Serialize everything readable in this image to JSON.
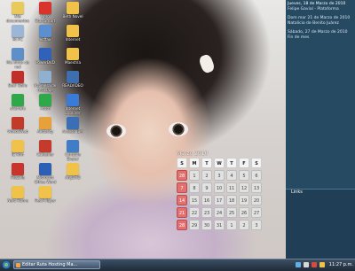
{
  "desktop_icons": [
    {
      "label": "Mis documentos",
      "color": "#e9c95a"
    },
    {
      "label": "Nero StartSmart",
      "color": "#d8342c"
    },
    {
      "label": "Beth Novel",
      "color": "#f0c24a"
    },
    {
      "label": "Mi PC",
      "color": "#9bb6d6"
    },
    {
      "label": "ecffax",
      "color": "#5b8fd0"
    },
    {
      "label": "Internet",
      "color": "#f0c24a"
    },
    {
      "label": "Mis sitios de red",
      "color": "#5f8fc8"
    },
    {
      "label": "PowerDVD",
      "color": "#2f62b8"
    },
    {
      "label": "Maestría",
      "color": "#f0c24a"
    },
    {
      "label": "Bee! Baile",
      "color": "#c03028"
    },
    {
      "label": "Papelera de reciclaje",
      "color": "#8fb0cf"
    },
    {
      "label": "REALVIDEO",
      "color": "#3d6fb0"
    },
    {
      "label": "uTorrent",
      "color": "#2fa84a"
    },
    {
      "label": "Atom",
      "color": "#2fa84a"
    },
    {
      "label": "Internet Explorer",
      "color": "#3b7bd8"
    },
    {
      "label": "Video2Web",
      "color": "#c13a2a"
    },
    {
      "label": "Audacity",
      "color": "#e7a13a"
    },
    {
      "label": "Acceso IBM",
      "color": "#3a6fb8"
    },
    {
      "label": "IE Rhn",
      "color": "#f0c24a"
    },
    {
      "label": "CCleaner",
      "color": "#c43a2c"
    },
    {
      "label": "Cartable Skate!",
      "color": "#3f7ec6"
    },
    {
      "label": "FileZilla",
      "color": "#c8352c"
    },
    {
      "label": "Microsoft Office Word",
      "color": "#2d5fb4"
    },
    {
      "label": "AnyDVD",
      "color": "#f0c24a"
    },
    {
      "label": "Nero Home",
      "color": "#f0c24a"
    },
    {
      "label": "Real Player",
      "color": "#f0c24a"
    }
  ],
  "sidebar": {
    "items": [
      "Jueves, 18 de Marzo de 2010",
      "Felipe Gavial - Plataforma",
      "Dom mar 21 de Marzo de 2010",
      "Natalicio de Benito Juárez",
      "Sábado, 27 de Marzo de 2010",
      "Fin de mes"
    ],
    "panel_title": "Links"
  },
  "calendar": {
    "title": "Marzo 2010",
    "headers": [
      "S",
      "M",
      "T",
      "W",
      "T",
      "F",
      "S"
    ],
    "weeks": [
      [
        "28",
        "1",
        "2",
        "3",
        "4",
        "5",
        "6"
      ],
      [
        "7",
        "8",
        "9",
        "10",
        "11",
        "12",
        "13"
      ],
      [
        "14",
        "15",
        "16",
        "17",
        "18",
        "19",
        "20"
      ],
      [
        "21",
        "22",
        "23",
        "24",
        "25",
        "26",
        "27"
      ],
      [
        "28",
        "29",
        "30",
        "31",
        "1",
        "2",
        "3"
      ]
    ]
  },
  "taskbar": {
    "window_label": "Editar Ruta Hosting Ma...",
    "clock": "11:27 p.m."
  },
  "colors": {
    "sidebar_bg": "#274a63",
    "taskbar": "#1e2a38",
    "sunday": "#e36f6f"
  }
}
